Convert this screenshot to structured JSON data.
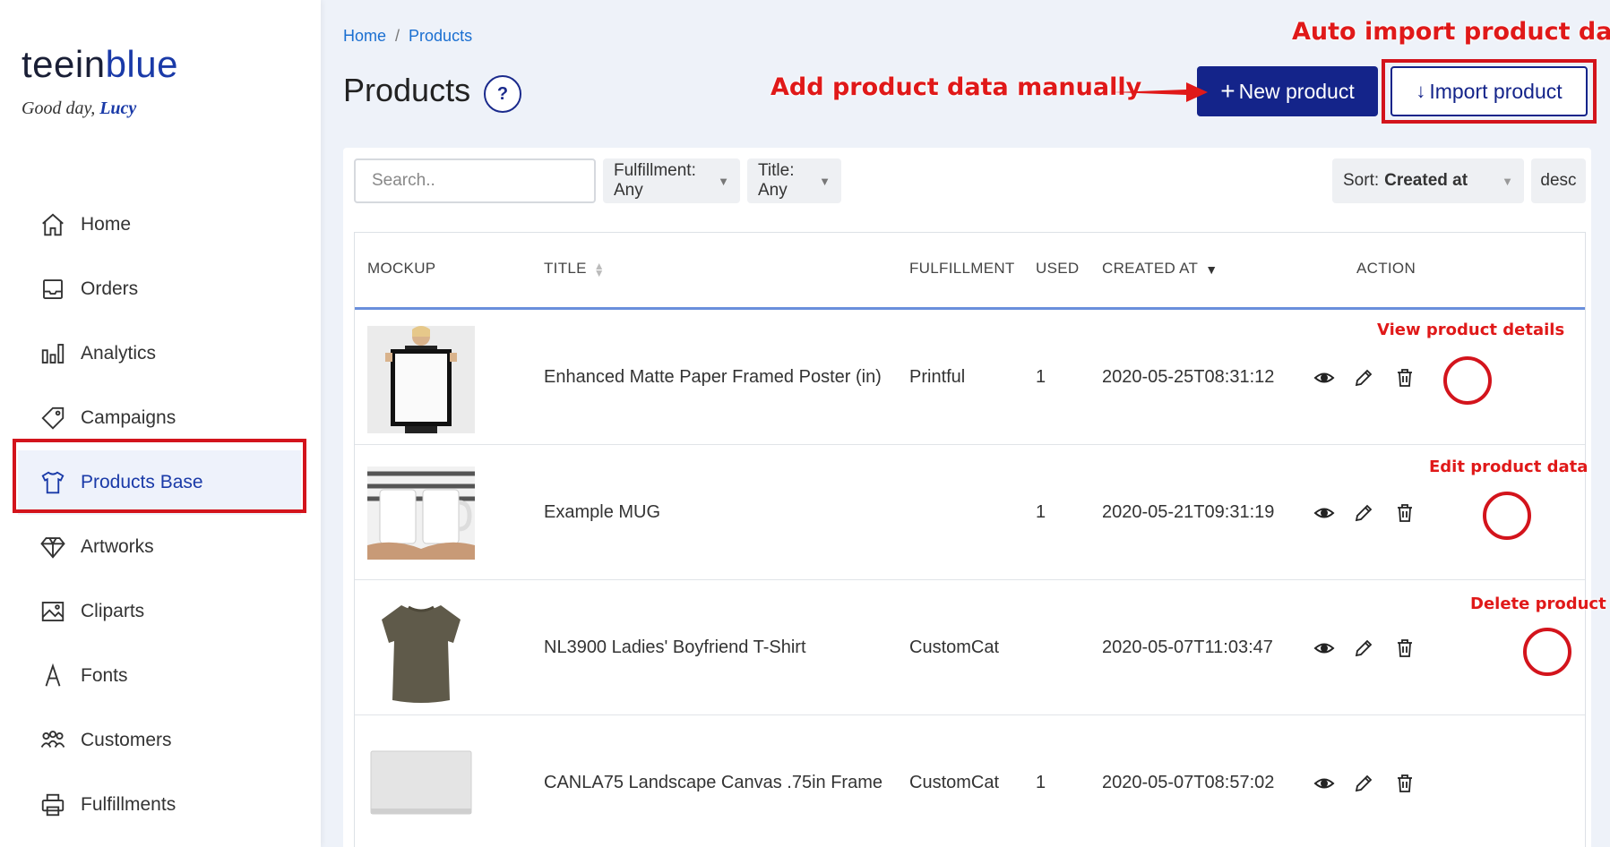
{
  "brand": {
    "part1": "teein",
    "part2": "blue"
  },
  "greeting": {
    "text": "Good day,",
    "user": "Lucy"
  },
  "nav": [
    {
      "label": "Home",
      "icon": "home-icon"
    },
    {
      "label": "Orders",
      "icon": "inbox-icon"
    },
    {
      "label": "Analytics",
      "icon": "bar-chart-icon"
    },
    {
      "label": "Campaigns",
      "icon": "tag-icon"
    },
    {
      "label": "Products Base",
      "icon": "tshirt-icon",
      "active": true
    },
    {
      "label": "Artworks",
      "icon": "diamond-icon"
    },
    {
      "label": "Cliparts",
      "icon": "image-icon"
    },
    {
      "label": "Fonts",
      "icon": "font-icon"
    },
    {
      "label": "Customers",
      "icon": "users-icon"
    },
    {
      "label": "Fulfillments",
      "icon": "printer-icon"
    }
  ],
  "breadcrumb": {
    "home": "Home",
    "separator": "/",
    "current": "Products"
  },
  "page": {
    "title": "Products",
    "help": "?"
  },
  "buttons": {
    "new_product": "New product",
    "new_plus": "+",
    "import_product": "Import product",
    "import_arrow": "↓"
  },
  "filters": {
    "search_placeholder": "Search..",
    "fulfillment": "Fulfillment: Any",
    "title": "Title: Any",
    "sort_label": "Sort:",
    "sort_value": "Created at",
    "order": "desc"
  },
  "table": {
    "headers": {
      "mockup": "Mockup",
      "title": "Title",
      "fulfillment": "Fulfillment",
      "used": "Used",
      "created_at": "Created at",
      "action": "Action"
    },
    "rows": [
      {
        "title": "Enhanced Matte Paper Framed Poster (in)",
        "fulfillment": "Printful",
        "used": "1",
        "created_at": "2020-05-25T08:31:12",
        "mockup": "framed-poster"
      },
      {
        "title": "Example MUG",
        "fulfillment": "",
        "used": "1",
        "created_at": "2020-05-21T09:31:19",
        "mockup": "mugs"
      },
      {
        "title": "NL3900 Ladies' Boyfriend T-Shirt",
        "fulfillment": "CustomCat",
        "used": "",
        "created_at": "2020-05-07T11:03:47",
        "mockup": "tshirt"
      },
      {
        "title": "CANLA75 Landscape Canvas .75in Frame",
        "fulfillment": "CustomCat",
        "used": "1",
        "created_at": "2020-05-07T08:57:02",
        "mockup": "canvas"
      }
    ]
  },
  "annotations": {
    "auto_import": "Auto import product data",
    "add_manual": "Add product data manually",
    "view_details": "View product details",
    "edit_data": "Edit product data",
    "delete_product": "Delete product"
  },
  "colors": {
    "accent": "#14248a",
    "link": "#1a6fd1",
    "annotation": "#d3141c",
    "header_underline": "#6a8fdc"
  }
}
